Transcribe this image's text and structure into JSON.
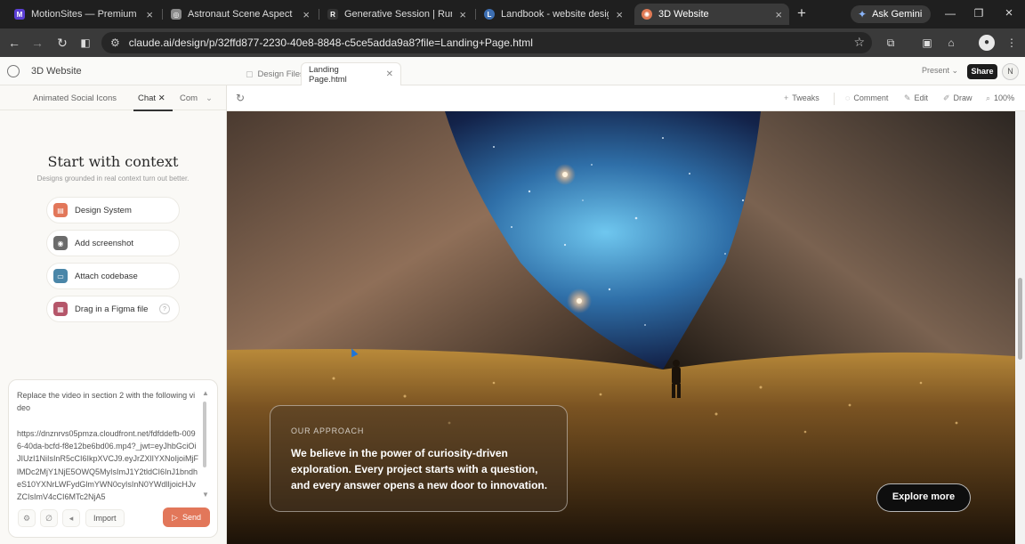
{
  "browser": {
    "tabs": [
      {
        "label": "MotionSites — Premium Hero",
        "fav_color": "#5b3fd4",
        "fav_glyph": "M"
      },
      {
        "label": "Astronaut Scene Aspect Ratio",
        "fav_color": "#8a8a8a",
        "fav_glyph": "◎"
      },
      {
        "label": "Generative Session | Runway AI",
        "fav_color": "#333333",
        "fav_glyph": "R"
      },
      {
        "label": "Landbook - website design insp",
        "fav_color": "#3d6fb3",
        "fav_glyph": "L"
      },
      {
        "label": "3D Website",
        "fav_color": "#e07a55",
        "fav_glyph": "✺"
      }
    ],
    "ask_gemini": "Ask Gemini",
    "url": "claude.ai/design/p/32ffd877-2230-40e8-8848-c5ce5adda9a8?file=Landing+Page.html"
  },
  "app": {
    "project_title": "3D Website",
    "file_tabs": [
      {
        "label": "Design Files"
      },
      {
        "label": "Landing Page.html"
      }
    ],
    "present_label": "Present ⌄",
    "share_label": "Share",
    "avatar_initial": "N"
  },
  "left_panel": {
    "tabs": [
      {
        "label": "Animated Social Icons"
      },
      {
        "label": "Chat ✕"
      },
      {
        "label": "Com"
      }
    ],
    "context_title": "Start with context",
    "context_subtitle": "Designs grounded in real context turn out better.",
    "context_options": [
      {
        "label": "Design System",
        "icon": "design-system-icon",
        "color": "#e2775a"
      },
      {
        "label": "Add screenshot",
        "icon": "screenshot-icon",
        "color": "#6b6b6b"
      },
      {
        "label": "Attach codebase",
        "icon": "codebase-icon",
        "color": "#4a86a8"
      },
      {
        "label": "Drag in a Figma file",
        "icon": "figma-icon",
        "color": "#b5566a"
      }
    ],
    "prompt_text": "Replace the video in section 2 with the following video\n\nhttps://dnznrvs05pmza.cloudfront.net/fdfddefb-0096-40da-bcfd-f8e12be6bd06.mp4?_jwt=eyJhbGciOiJIUzI1NiIsInR5cCI6IkpXVCJ9.eyJrZXlIYXNoIjoiMjFlMDc2MjY1NjE5OWQ5MyIsImJ1Y2tldCI6InJ1bndheS10YXNrLWFydGlmYWN0cyIsInN0YWdlIjoicHJvZCIsImV4cCI6MTc2NjA5",
    "import_label": "Import",
    "send_label": "Send"
  },
  "canvas_toolbar": {
    "tweaks": "Tweaks",
    "comment": "Comment",
    "edit": "Edit",
    "draw": "Draw",
    "zoom": "100%"
  },
  "preview": {
    "kicker": "OUR APPROACH",
    "body": "We believe in the power of curiosity-driven exploration. Every project starts with a question, and every answer opens a new door to innovation.",
    "cta": "Explore more"
  }
}
